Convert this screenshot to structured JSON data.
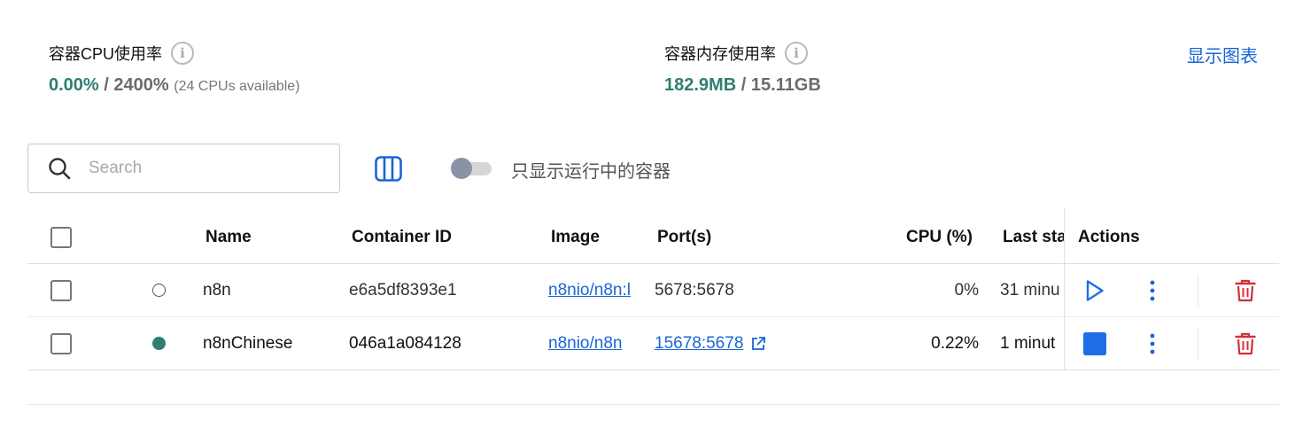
{
  "stats": {
    "cpu": {
      "label": "容器CPU使用率",
      "used": "0.00%",
      "separator": " / ",
      "total": "2400%",
      "note": "(24 CPUs available)"
    },
    "memory": {
      "label": "容器内存使用率",
      "used": "182.9MB",
      "separator": " / ",
      "total": "15.11GB"
    },
    "info_icon_glyph": "i",
    "show_chart_label": "显示图表"
  },
  "toolbar": {
    "search_placeholder": "Search",
    "search_value": "",
    "running_only_label": "只显示运行中的容器",
    "running_only_enabled": false
  },
  "table": {
    "headers": {
      "name": "Name",
      "container_id": "Container ID",
      "image": "Image",
      "ports": "Port(s)",
      "cpu": "CPU (%)",
      "last_started": "Last sta",
      "actions": "Actions"
    },
    "rows": [
      {
        "status": "stopped",
        "name": "n8n",
        "container_id": "e6a5df8393e1",
        "image": "n8nio/n8n:l",
        "port": "5678:5678",
        "cpu": "0%",
        "last_started": "31 minu",
        "primary_action": "start"
      },
      {
        "status": "running",
        "name": "n8nChinese",
        "container_id": "046a1a084128",
        "image": "n8nio/n8n",
        "port": "15678:5678",
        "cpu": "0.22%",
        "last_started": "1 minut",
        "primary_action": "stop"
      }
    ]
  },
  "colors": {
    "accent_green": "#2f7f6f",
    "link_blue": "#1a66d6",
    "delete_red": "#d32f3a",
    "stop_blue": "#1e6ee8"
  }
}
